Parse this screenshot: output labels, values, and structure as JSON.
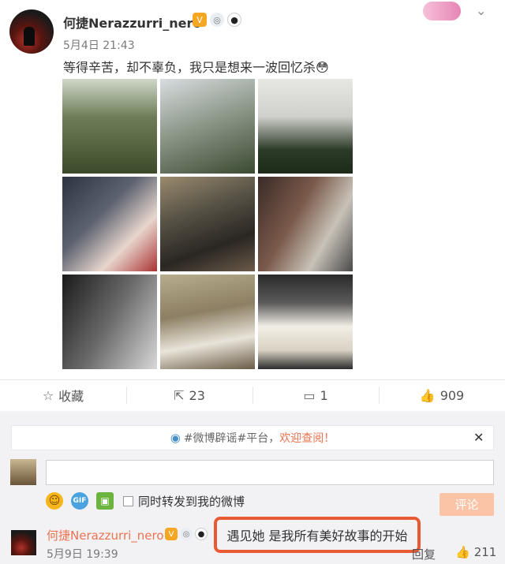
{
  "header": {
    "username": "何捷Nerazzurri_nero",
    "timestamp": "5月4日 21:43",
    "badges": [
      "vip-icon",
      "ring-icon",
      "panda-icon"
    ],
    "menu_icon": "chevron-down-icon"
  },
  "post": {
    "caption": "等得辛苦，却不辜负，我只是想来一波回忆杀😳",
    "photos": [
      "photo-1",
      "photo-2",
      "photo-3",
      "photo-4",
      "photo-5",
      "photo-6",
      "photo-7",
      "photo-8",
      "photo-9"
    ]
  },
  "actions": {
    "favorite": {
      "icon": "star-icon",
      "label": "收藏"
    },
    "repost": {
      "icon": "share-icon",
      "count": "23"
    },
    "comment": {
      "icon": "comment-icon",
      "count": "1"
    },
    "like": {
      "icon": "thumbs-up-icon",
      "count": "909"
    }
  },
  "notice": {
    "icon": "weibo-clarify-icon",
    "topic": "#微博辟谣#平台，",
    "link": "欢迎查阅！",
    "close_icon": "close-icon"
  },
  "composer": {
    "input_value": "",
    "tools": [
      "emoji-icon",
      "gif-icon",
      "image-icon"
    ],
    "repost_label": "同时转发到我的微博",
    "submit_label": "评论"
  },
  "comments": [
    {
      "name": "何捷Nerazzurri_nero",
      "text": "遇见她 是我所有美好故事的开始",
      "time": "5月9日 19:39",
      "reply_label": "回复",
      "likes": "211"
    }
  ],
  "colors": {
    "accent": "#eb7350",
    "highlight_border": "#e85a34",
    "submit_bg": "#fbc4a6"
  }
}
